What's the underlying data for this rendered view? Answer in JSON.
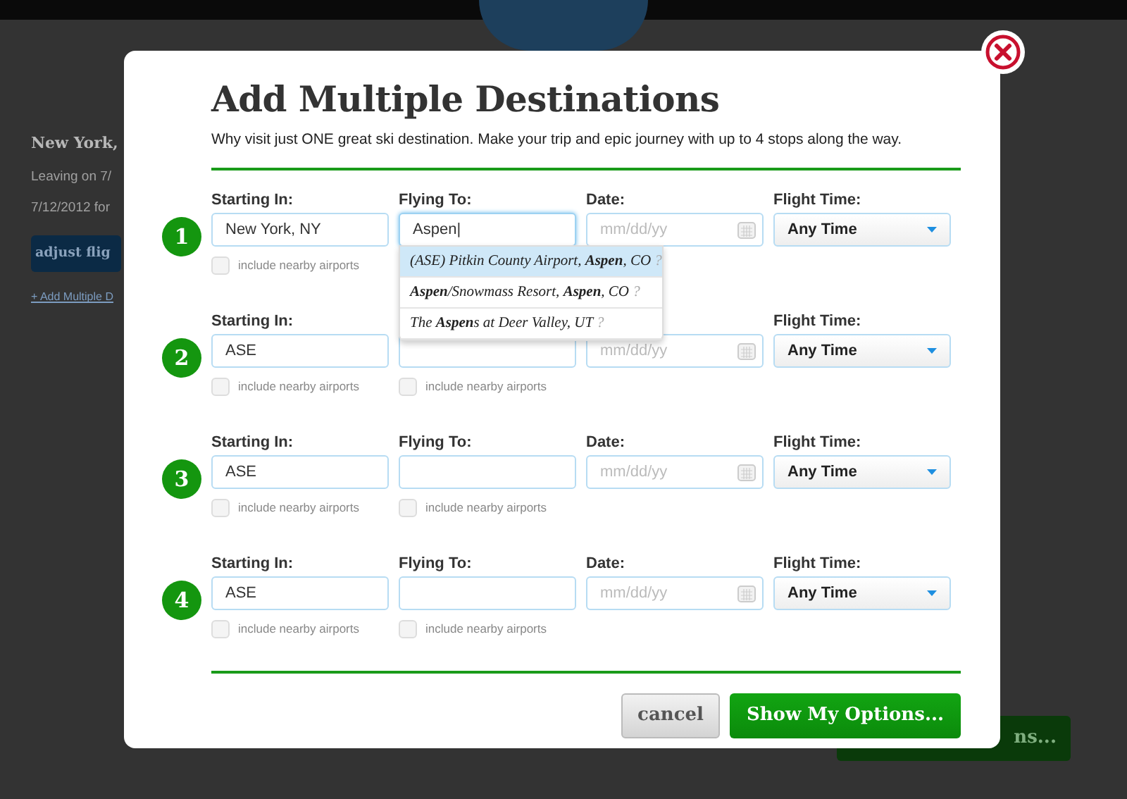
{
  "background": {
    "heading": "New York,",
    "lines": [
      "Leaving on 7/",
      "7/12/2012 for"
    ],
    "adjust_button": "adjust flig",
    "add_link": "+ Add Multiple D",
    "bottom_button": "ns..."
  },
  "dialog": {
    "title": "Add Multiple Destinations",
    "subtitle": "Why visit just ONE great ski destination. Make your trip and epic journey with up to 4 stops along the way.",
    "rows": [
      {
        "number": "1",
        "starting": {
          "label": "Starting In:",
          "value": "New York, NY",
          "nearby": {
            "label": "include nearby airports",
            "checked": false
          }
        },
        "flying": {
          "label": "Flying To:",
          "value": "Aspen|",
          "focused": true
        },
        "date": {
          "label": "Date:",
          "placeholder": "mm/dd/yy"
        },
        "time": {
          "label": "Flight Time:",
          "value": "Any Time"
        }
      },
      {
        "number": "2",
        "starting": {
          "label": "Starting In:",
          "value": "ASE",
          "nearby": {
            "label": "include nearby airports",
            "checked": false
          }
        },
        "flying": {
          "focused": false,
          "nearby": {
            "label": "include nearby airports",
            "checked": false
          }
        },
        "date": {
          "placeholder": "mm/dd/yy"
        },
        "time": {
          "label": "Flight Time:",
          "value": "Any Time"
        }
      },
      {
        "number": "3",
        "starting": {
          "label": "Starting In:",
          "value": "ASE",
          "nearby": {
            "label": "include nearby airports",
            "checked": false
          }
        },
        "flying": {
          "label": "Flying To:",
          "focused": false,
          "nearby": {
            "label": "include nearby airports",
            "checked": false
          }
        },
        "date": {
          "label": "Date:",
          "placeholder": "mm/dd/yy"
        },
        "time": {
          "label": "Flight Time:",
          "value": "Any Time"
        }
      },
      {
        "number": "4",
        "starting": {
          "label": "Starting In:",
          "value": "ASE",
          "nearby": {
            "label": "include nearby airports",
            "checked": false
          }
        },
        "flying": {
          "label": "Flying To:",
          "focused": false,
          "nearby": {
            "label": "include nearby airports",
            "checked": false
          }
        },
        "date": {
          "label": "Date:",
          "placeholder": "mm/dd/yy"
        },
        "time": {
          "label": "Flight Time:",
          "value": "Any Time"
        }
      }
    ],
    "suggestions": [
      {
        "text": "(ASE) Pitkin County Airport, **Aspen**, CO",
        "hint": "?",
        "selected": true
      },
      {
        "text": "**Aspen**/Snowmass Resort, **Aspen**, CO",
        "hint": "?",
        "selected": false
      },
      {
        "text": "The **Aspen**s at Deer Valley, UT",
        "hint": "?",
        "selected": false
      }
    ],
    "cancel": "cancel",
    "submit": "Show My Options..."
  }
}
